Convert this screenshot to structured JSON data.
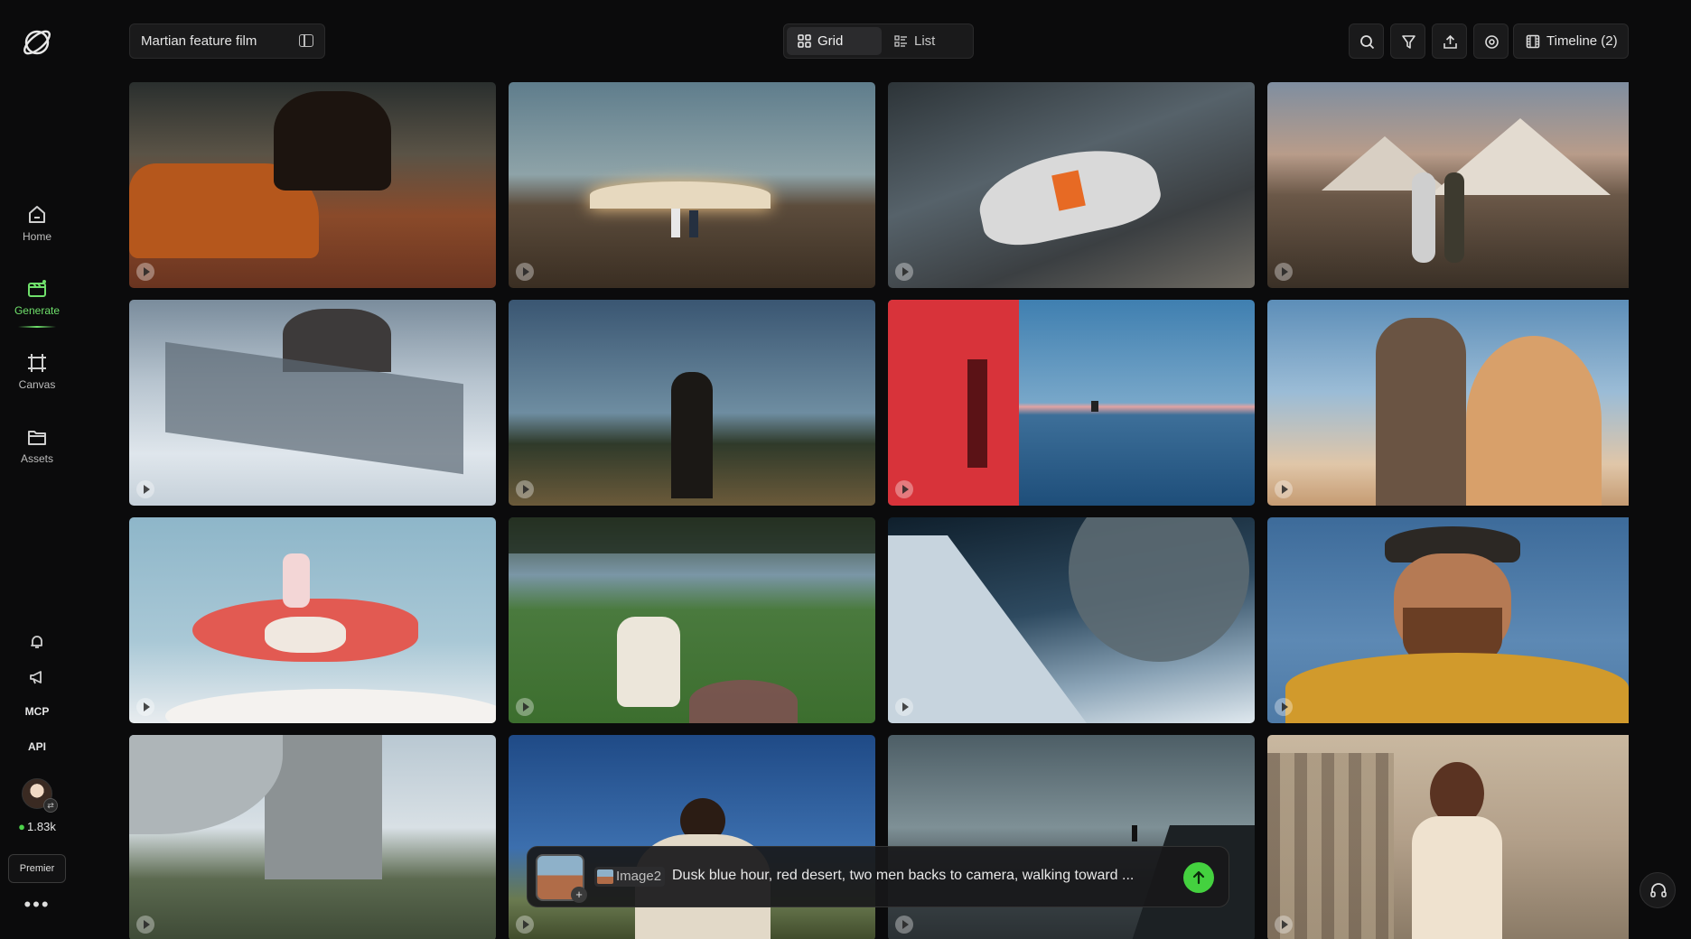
{
  "sidebar": {
    "nav": [
      {
        "label": "Home",
        "icon": "home-icon"
      },
      {
        "label": "Generate",
        "icon": "generate-icon",
        "active": true
      },
      {
        "label": "Canvas",
        "icon": "canvas-icon"
      },
      {
        "label": "Assets",
        "icon": "folder-icon"
      }
    ],
    "mcp_label": "MCP",
    "api_label": "API",
    "credits": "1.83k",
    "premier_label": "Premier",
    "more_label": "•••"
  },
  "header": {
    "project_name": "Martian feature film",
    "view_tabs": [
      {
        "label": "Grid",
        "active": true
      },
      {
        "label": "List",
        "active": false
      }
    ],
    "timeline_label": "Timeline (2)"
  },
  "grid": {
    "tiles": [
      {
        "subject": "red sports car and horse in desert"
      },
      {
        "subject": "desert base at dusk with two astronauts"
      },
      {
        "subject": "racing car number 2 in storm"
      },
      {
        "subject": "astronaut and man walking toward pyramids"
      },
      {
        "subject": "snow temple on frozen waterfall"
      },
      {
        "subject": "man in dark coat on hill"
      },
      {
        "subject": "red wall and rider on reflective salt flat"
      },
      {
        "subject": "woman with dog under sign"
      },
      {
        "subject": "girl riding koi fish in sky"
      },
      {
        "subject": "woman in chair on lawn by sea"
      },
      {
        "subject": "skier under giant planet"
      },
      {
        "subject": "bearded man in orange sweater"
      },
      {
        "subject": "concrete monolith over grassland"
      },
      {
        "subject": "man on grass under blue sky"
      },
      {
        "subject": "lone figure on rocky shore"
      },
      {
        "subject": "woman in courtyard with arches"
      }
    ]
  },
  "prompt": {
    "chip_label": "Image2",
    "text": "Dusk blue hour, red desert, two men backs to camera, walking toward ...",
    "attach_label": "+"
  },
  "colors": {
    "accent": "#44d13f",
    "background": "#0b0b0c"
  }
}
